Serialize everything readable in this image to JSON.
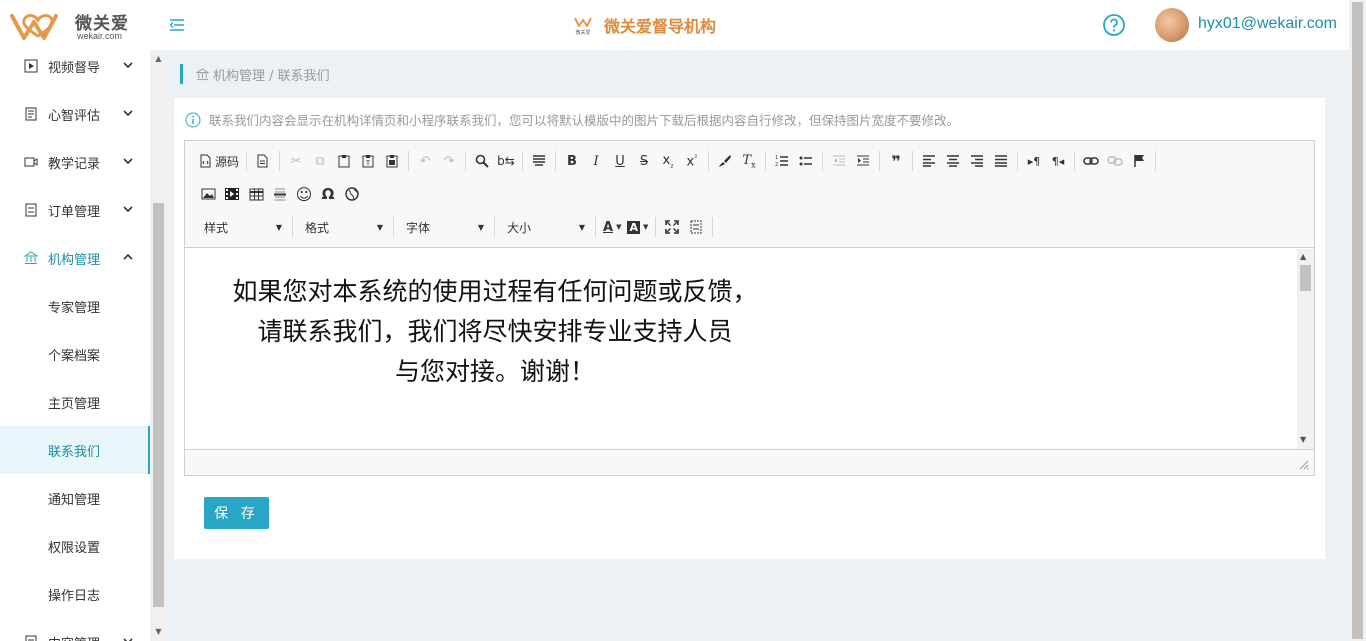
{
  "app": {
    "logo_text": "微关爱",
    "logo_sub": "wekair.com",
    "title": "微关爱督导机构",
    "mini_logo_text": "微关爱",
    "user_email": "hyx01@wekair.com",
    "accent": "#29a5c5",
    "title_color": "#e08a3c"
  },
  "sidebar": {
    "items": [
      {
        "label": "视频督导",
        "icon": "video-icon"
      },
      {
        "label": "心智评估",
        "icon": "document-icon"
      },
      {
        "label": "教学记录",
        "icon": "camera-icon"
      },
      {
        "label": "订单管理",
        "icon": "list-icon"
      },
      {
        "label": "机构管理",
        "icon": "institution-icon"
      }
    ],
    "sub_items": [
      "专家管理",
      "个案档案",
      "主页管理",
      "联系我们",
      "通知管理",
      "权限设置",
      "操作日志"
    ],
    "last_item": {
      "label": "内容管理"
    }
  },
  "breadcrumb": {
    "text": "机构管理 / 联系我们"
  },
  "notice": {
    "text": "联系我们内容会显示在机构详情页和小程序联系我们，您可以将默认模版中的图片下载后根据内容自行修改，但保持图片宽度不要修改。"
  },
  "toolbar": {
    "source_label": "源码",
    "combos": {
      "style": "样式",
      "format": "格式",
      "font": "字体",
      "size": "大小"
    }
  },
  "editor": {
    "lines": [
      "如果您对本系统的使用过程有任何问题或反馈，",
      "请联系我们，我们将尽快安排专业支持人员",
      "与您对接。谢谢！"
    ]
  },
  "save_label": "保 存"
}
